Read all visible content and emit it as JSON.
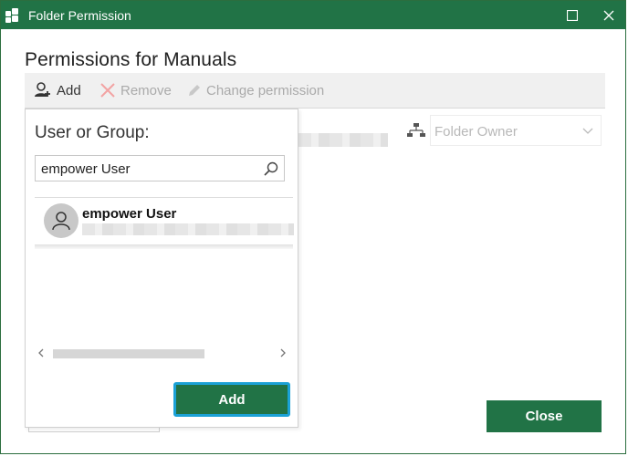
{
  "window": {
    "title": "Folder Permission"
  },
  "page": {
    "title": "Permissions for Manuals"
  },
  "toolbar": {
    "add_label": "Add",
    "remove_label": "Remove",
    "change_label": "Change permission"
  },
  "permission": {
    "placeholder": "Folder Owner"
  },
  "popup": {
    "title": "User or Group:",
    "search_value": "empower User",
    "results": [
      {
        "name": "empower User"
      }
    ],
    "add_label": "Add"
  },
  "footer": {
    "close_label": "Close"
  },
  "colors": {
    "accent": "#217346",
    "focus": "#1ba1d6",
    "disabled": "#b8b8b8"
  }
}
